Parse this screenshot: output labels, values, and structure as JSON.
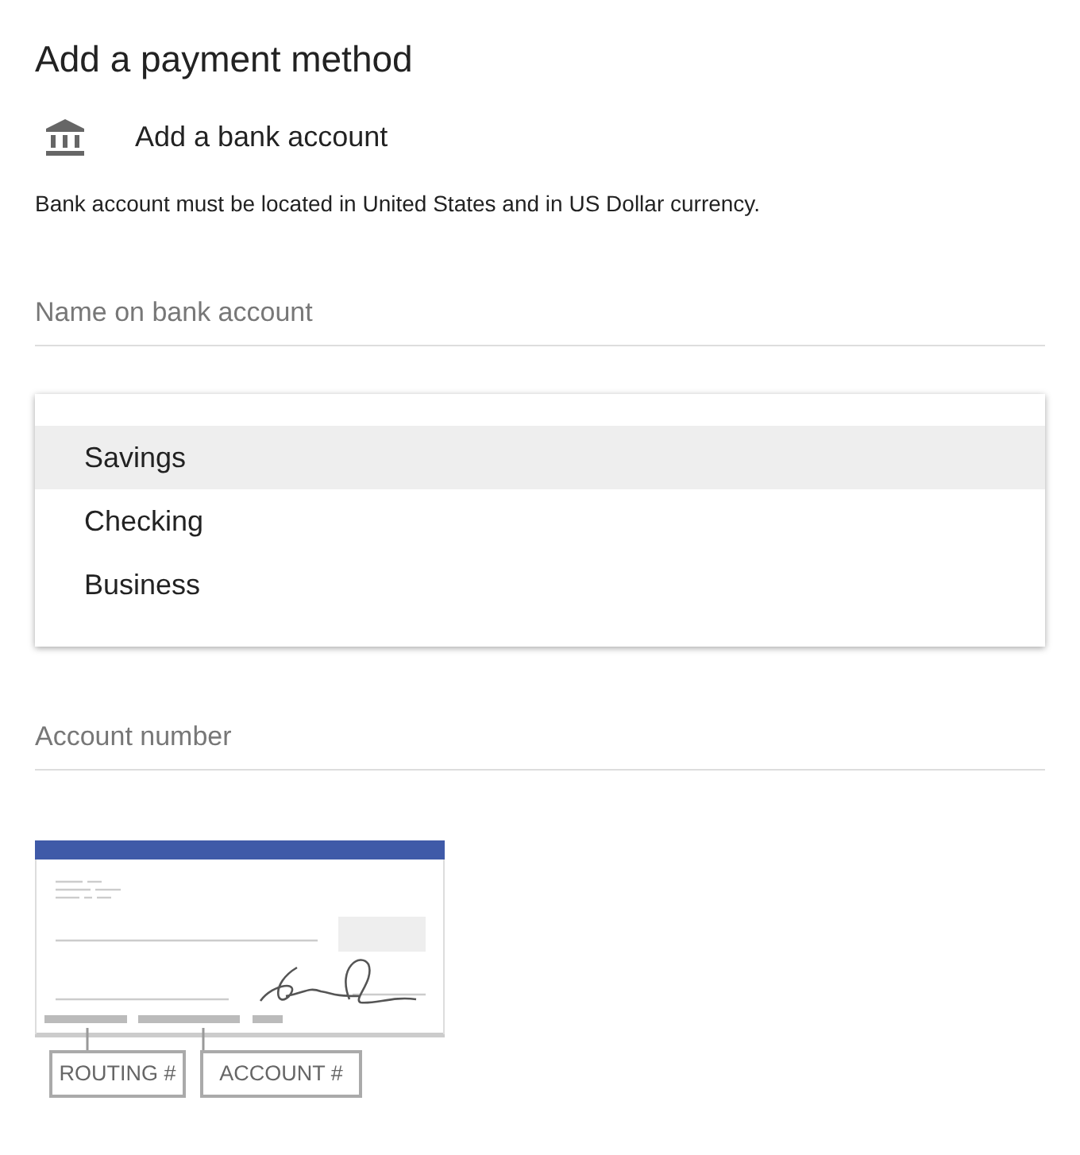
{
  "title": "Add a payment method",
  "method": {
    "label": "Add a bank account"
  },
  "note": "Bank account must be located in United States and in US Dollar currency.",
  "name_field": {
    "placeholder": "Name on bank account"
  },
  "account_type_menu": {
    "options": [
      {
        "label": "Savings",
        "selected": true
      },
      {
        "label": "Checking",
        "selected": false
      },
      {
        "label": "Business",
        "selected": false
      }
    ]
  },
  "account_field": {
    "placeholder": "Account number"
  },
  "check_labels": [
    "ROUTING #",
    "ACCOUNT #"
  ]
}
